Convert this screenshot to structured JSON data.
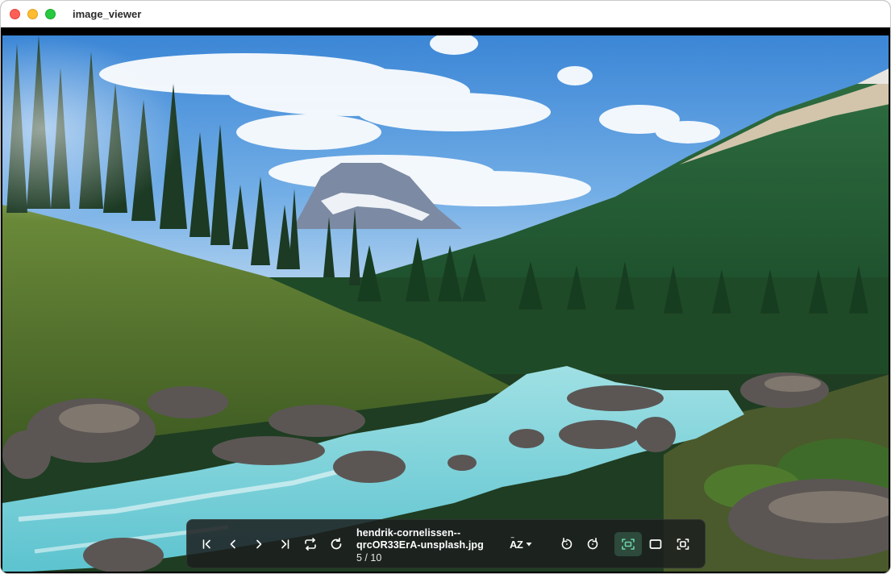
{
  "window": {
    "title": "image_viewer"
  },
  "toolbar": {
    "file_name_line1": "hendrik-cornelissen--",
    "file_name_line2": "qrcOR33ErA-unsplash.jpg",
    "counter": "5 / 10",
    "sort_label": "AZ",
    "buttons": [
      {
        "name": "first-image-button",
        "icon": "skip-first-icon"
      },
      {
        "name": "previous-image-button",
        "icon": "chevron-left-icon"
      },
      {
        "name": "next-image-button",
        "icon": "chevron-right-icon"
      },
      {
        "name": "last-image-button",
        "icon": "skip-last-icon"
      },
      {
        "name": "shuffle-button",
        "icon": "repeat-icon"
      },
      {
        "name": "reload-button",
        "icon": "refresh-icon"
      },
      {
        "name": "sort-button",
        "icon": "sort-az-icon"
      },
      {
        "name": "rotate-left-button",
        "icon": "rotate-ccw-icon"
      },
      {
        "name": "rotate-right-button",
        "icon": "rotate-cw-icon"
      },
      {
        "name": "fit-to-window-button",
        "icon": "fit-screen-icon",
        "active": true
      },
      {
        "name": "actual-size-button",
        "icon": "rectangle-icon"
      },
      {
        "name": "fullscreen-button",
        "icon": "focus-frame-icon"
      }
    ]
  },
  "colors": {
    "accent": "#6fd3a8",
    "toolbar_bg": "#1c1e1e"
  }
}
